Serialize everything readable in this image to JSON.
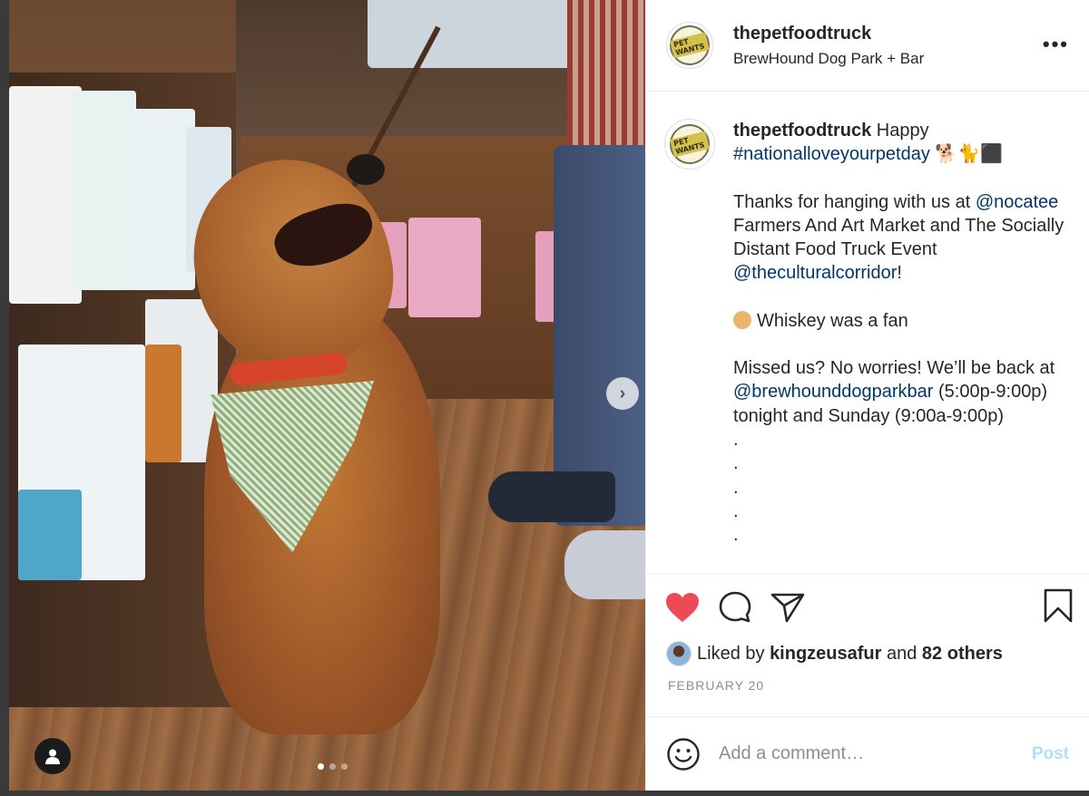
{
  "post": {
    "username": "thepetfoodtruck",
    "location": "BrewHound Dog Park + Bar",
    "avatar_text": "PET WANTS",
    "more_label": "•••",
    "caption": {
      "username": "thepetfoodtruck",
      "word1": "Happy",
      "hashtag": "#nationalloveyourpetday",
      "emojis": "🐕🐈⬛",
      "p1_pre": "Thanks for hanging with us at",
      "mention1": "@nocatee",
      "p1_mid": "Farmers And Art Market and The Socially Distant Food Truck Event",
      "mention2": "@theculturalcorridor",
      "p1_end": "!",
      "p2": "Whiskey was a fan",
      "p3_pre": "Missed us? No worries! We’ll be back at",
      "mention3": "@brewhounddogparkbar",
      "p3_end": "(5:00p-9:00p) tonight and Sunday (9:00a-9:00p)",
      "dots": [
        ".",
        ".",
        ".",
        ".",
        "."
      ]
    },
    "likes": {
      "prefix": "Liked by",
      "liker": "kingzeusafur",
      "and": "and",
      "others": "82 others"
    },
    "date": "FEBRUARY 20",
    "comment": {
      "placeholder": "Add a comment…",
      "post_label": "Post"
    },
    "carousel": {
      "next_label": "›",
      "slide_count": 3,
      "active_slide": 1
    }
  },
  "colors": {
    "like_red": "#ed4956",
    "link_blue": "#00376b",
    "post_button_disabled": "#b2dffc",
    "muted_text": "#8e8e8e"
  },
  "icons": [
    "heart-icon",
    "comment-icon",
    "share-icon",
    "bookmark-icon",
    "smile-icon",
    "user-tag-icon",
    "chevron-right-icon",
    "more-icon"
  ]
}
